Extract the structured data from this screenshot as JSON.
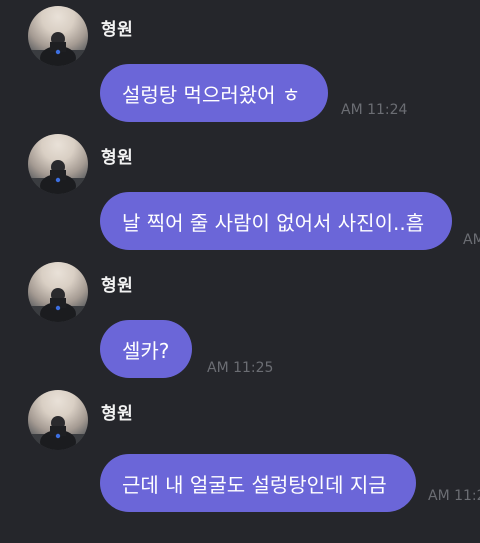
{
  "messages": [
    {
      "sender": "형원",
      "text": "설렁탕 먹으러왔어 ㅎ",
      "time": "AM 11:24"
    },
    {
      "sender": "형원",
      "text": "날 찍어 줄 사람이 없어서 사진이..흠",
      "time": "AM"
    },
    {
      "sender": "형원",
      "text": "셀카?",
      "time": "AM 11:25"
    },
    {
      "sender": "형원",
      "text": "근데 내 얼굴도 설렁탕인데 지금",
      "time": "AM 11:2"
    }
  ],
  "colors": {
    "background": "#25262b",
    "bubble": "#6b66d8",
    "timestamp": "#6b6d73"
  },
  "icons": [
    "avatar-photo"
  ]
}
